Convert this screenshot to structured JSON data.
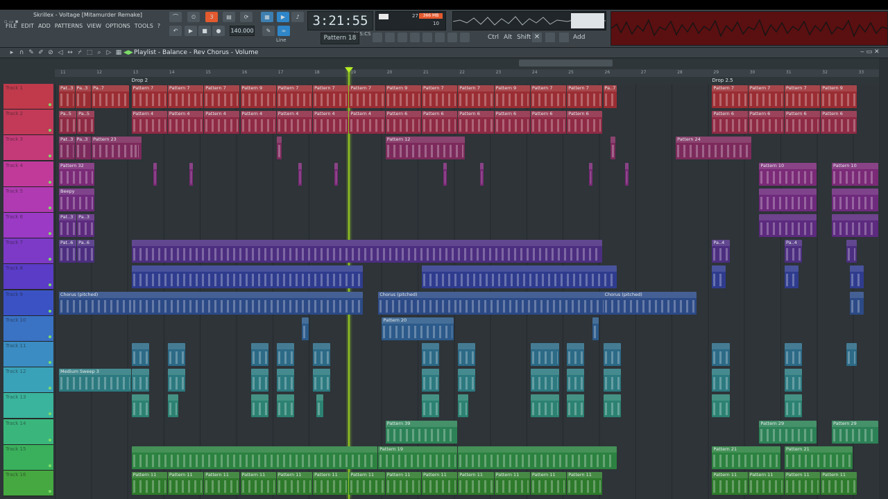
{
  "window": {
    "title": "Skrillex - Voltage [Mitamurder Remake]",
    "menu": [
      "FILE",
      "EDIT",
      "ADD",
      "PATTERNS",
      "VIEW",
      "OPTIONS",
      "TOOLS",
      "?"
    ]
  },
  "transport": {
    "time": "3:21:55",
    "bars_label": "M:S:CS",
    "tempo": "140.000",
    "pattern": "Pattern 18",
    "snap": "Line",
    "cpu_text": "27",
    "mem_text": "366 MB",
    "poly_text": "10"
  },
  "keys": [
    "Ctrl",
    "Alt",
    "Shift",
    "Add"
  ],
  "colors": {
    "accent_orange": "#e35a2f",
    "playhead": "#8fc41f",
    "oscilloscope": "#c01818"
  },
  "playlist": {
    "title": "Playlist - Balance - Rev Chorus - Volume",
    "bars": [
      "11",
      "12",
      "13",
      "14",
      "15",
      "16",
      "17",
      "18",
      "19",
      "20",
      "21",
      "22",
      "23",
      "24",
      "25",
      "26",
      "27",
      "28",
      "29",
      "30",
      "31",
      "32",
      "33"
    ],
    "markers": [
      {
        "text": "Drop 2",
        "bar": 13
      },
      {
        "text": "Drop 2.5",
        "bar": 29
      }
    ],
    "tracks": [
      {
        "name": "Track 1",
        "color": "#c03a4c",
        "clip_color": "#9a2d33",
        "clips": [
          [
            "Pat..3",
            11,
            11.45
          ],
          [
            "Pa..3",
            11.45,
            11.9
          ],
          [
            "Pa..7",
            11.9,
            12.95
          ],
          [
            "Pattern 7",
            13,
            14
          ],
          [
            "Pattern 7",
            14,
            15
          ],
          [
            "Pattern 7",
            15,
            16
          ],
          [
            "Pattern 9",
            16,
            17
          ],
          [
            "Pattern 7",
            17,
            18
          ],
          [
            "Pattern 7",
            18,
            19
          ],
          [
            "Pattern 7",
            19,
            20
          ],
          [
            "Pattern 9",
            20,
            21
          ],
          [
            "Pattern 7",
            21,
            22
          ],
          [
            "Pattern 7",
            22,
            23
          ],
          [
            "Pattern 9",
            23,
            24
          ],
          [
            "Pattern 7",
            24,
            25
          ],
          [
            "Pattern 7",
            25,
            26
          ],
          [
            "Pa..7",
            26,
            26.4
          ],
          [
            "Pattern 7",
            29,
            30
          ],
          [
            "Pattern 7",
            30,
            31
          ],
          [
            "Pattern 7",
            31,
            32
          ],
          [
            "Pattern 9",
            32,
            33
          ]
        ]
      },
      {
        "name": "Track 2",
        "color": "#c23a58",
        "clip_color": "#8e2a44",
        "clips": [
          [
            "Pa..5",
            11,
            11.5
          ],
          [
            "Pa..5",
            11.5,
            12
          ],
          [
            "Pattern 4",
            13,
            14
          ],
          [
            "Pattern 4",
            14,
            15
          ],
          [
            "Pattern 4",
            15,
            16
          ],
          [
            "Pattern 4",
            16,
            17
          ],
          [
            "Pattern 4",
            17,
            18
          ],
          [
            "Pattern 4",
            18,
            19
          ],
          [
            "Pattern 4",
            19,
            20
          ],
          [
            "Pattern 6",
            20,
            21
          ],
          [
            "Pattern 6",
            21,
            22
          ],
          [
            "Pattern 6",
            22,
            23
          ],
          [
            "Pattern 6",
            23,
            24
          ],
          [
            "Pattern 6",
            24,
            25
          ],
          [
            "Pattern 6",
            25,
            26
          ],
          [
            "Pattern 6",
            29,
            30
          ],
          [
            "Pattern 6",
            30,
            31
          ],
          [
            "Pattern 6",
            31,
            32
          ],
          [
            "Pattern 6",
            32,
            33
          ]
        ]
      },
      {
        "name": "Track 3",
        "color": "#c43a78",
        "clip_color": "#7c2a5c",
        "clips": [
          [
            "Pat..3",
            11,
            11.45
          ],
          [
            "Pa..3",
            11.45,
            11.9
          ],
          [
            "Pattern 23",
            11.9,
            13.3
          ],
          [
            "",
            13.05,
            13.2
          ],
          [
            "",
            17,
            17.15
          ],
          [
            "Pattern 12",
            20,
            22.2
          ],
          [
            "",
            26.2,
            26.35
          ],
          [
            "Pattern 24",
            28,
            30.1
          ]
        ]
      },
      {
        "name": "Track 4",
        "color": "#c13a9a",
        "clip_color": "#7a2a76",
        "clips": [
          [
            "Pattern 32",
            11,
            12
          ],
          [
            "",
            13.6,
            13.7
          ],
          [
            "",
            14.6,
            14.7
          ],
          [
            "",
            17.6,
            17.7
          ],
          [
            "",
            18.6,
            18.7
          ],
          [
            "",
            21.6,
            21.7
          ],
          [
            "",
            22.6,
            22.7
          ],
          [
            "",
            25.6,
            25.7
          ],
          [
            "",
            26.6,
            26.7
          ],
          [
            "Pattern 10",
            30.3,
            31.9
          ],
          [
            "Pattern 10",
            32.3,
            33.6
          ]
        ]
      },
      {
        "name": "Track 5",
        "color": "#b03ab2",
        "clip_color": "#6e2a7c",
        "clips": [
          [
            "Beepy",
            11,
            12
          ],
          [
            "",
            30.3,
            31.9
          ],
          [
            "",
            32.3,
            33.6
          ]
        ]
      },
      {
        "name": "Track 6",
        "color": "#9b3ac4",
        "clip_color": "#5c2a7e",
        "clips": [
          [
            "Pat..3",
            11,
            11.5
          ],
          [
            "Pa..3",
            11.5,
            12
          ],
          [
            "",
            30.3,
            31.9
          ],
          [
            "",
            32.3,
            33.6
          ]
        ]
      },
      {
        "name": "Track 7",
        "color": "#7c3ac6",
        "clip_color": "#4c2e80",
        "clips": [
          [
            "Pat..6",
            11,
            11.5
          ],
          [
            "Pa..6",
            11.5,
            12
          ],
          [
            "",
            13,
            26
          ],
          [
            "Pa..4",
            29,
            29.5
          ],
          [
            "Pa..4",
            31,
            31.5
          ],
          [
            "",
            32.7,
            33
          ]
        ]
      },
      {
        "name": "Track 8",
        "color": "#5a3cc6",
        "clip_color": "#2f3c8e",
        "clips": [
          [
            "",
            13,
            19.4
          ],
          [
            "",
            21,
            26.4
          ],
          [
            "",
            29,
            29.4
          ],
          [
            "",
            31,
            31.4
          ],
          [
            "",
            32.8,
            33.2
          ]
        ]
      },
      {
        "name": "Track 9",
        "color": "#3a52c4",
        "clip_color": "#2c4a86",
        "clips": [
          [
            "Chorus (pitched)",
            11,
            13.5
          ],
          [
            "",
            13,
            19.4
          ],
          [
            "Chorus (pitched)",
            19.8,
            22.3
          ],
          [
            "",
            22,
            26.4
          ],
          [
            "Chorus (pitched)",
            26,
            28.6
          ],
          [
            "",
            32.8,
            33.2
          ]
        ]
      },
      {
        "name": "Track 10",
        "color": "#3a72c4",
        "clip_color": "#2c5a8a",
        "clips": [
          [
            "",
            17.7,
            17.9
          ],
          [
            "Pattern 20",
            19.9,
            21.9
          ],
          [
            "",
            25.7,
            25.9
          ]
        ]
      },
      {
        "name": "Track 11",
        "color": "#3a8cc2",
        "clip_color": "#2c6a86",
        "clips": [
          [
            "",
            13,
            13.5
          ],
          [
            "",
            14,
            14.5
          ],
          [
            "",
            16.3,
            16.8
          ],
          [
            "",
            17,
            17.5
          ],
          [
            "",
            18,
            18.5
          ],
          [
            "",
            21,
            21.5
          ],
          [
            "",
            22,
            22.5
          ],
          [
            "",
            24,
            24.8
          ],
          [
            "",
            25,
            25.5
          ],
          [
            "",
            26,
            26.5
          ],
          [
            "",
            29,
            29.5
          ],
          [
            "",
            31,
            31.5
          ],
          [
            "",
            32.7,
            33
          ]
        ]
      },
      {
        "name": "Track 12",
        "color": "#3aa2b8",
        "clip_color": "#2c7a80",
        "clips": [
          [
            "Medium Sweep 3",
            11,
            13
          ],
          [
            "",
            13,
            13.5
          ],
          [
            "",
            14,
            14.5
          ],
          [
            "",
            16.3,
            16.8
          ],
          [
            "",
            17,
            17.5
          ],
          [
            "",
            18,
            18.5
          ],
          [
            "",
            21,
            21.5
          ],
          [
            "",
            22,
            22.5
          ],
          [
            "",
            24,
            24.8
          ],
          [
            "",
            25,
            25.5
          ],
          [
            "",
            26,
            26.5
          ],
          [
            "",
            29,
            29.5
          ],
          [
            "",
            31,
            31.5
          ]
        ]
      },
      {
        "name": "Track 13",
        "color": "#3ab49c",
        "clip_color": "#2c8272",
        "clips": [
          [
            "",
            13,
            13.5
          ],
          [
            "",
            14,
            14.3
          ],
          [
            "",
            16.3,
            16.8
          ],
          [
            "",
            17,
            17.5
          ],
          [
            "",
            18.1,
            18.3
          ],
          [
            "",
            21,
            21.5
          ],
          [
            "",
            22,
            22.3
          ],
          [
            "",
            24,
            24.8
          ],
          [
            "",
            25,
            25.5
          ],
          [
            "",
            26,
            26.5
          ],
          [
            "",
            29,
            29.5
          ],
          [
            "",
            31,
            31.5
          ]
        ]
      },
      {
        "name": "Track 14",
        "color": "#3ab67c",
        "clip_color": "#2c8256",
        "clips": [
          [
            "Pattern 39",
            20,
            22
          ],
          [
            "Pattern 29",
            30.3,
            31.9
          ],
          [
            "Pattern 29",
            32.3,
            33.6
          ]
        ]
      },
      {
        "name": "Track 15",
        "color": "#3ab05c",
        "clip_color": "#2c8240",
        "clips": [
          [
            "",
            13,
            19.8
          ],
          [
            "Pattern 19",
            19.8,
            22
          ],
          [
            "",
            22,
            26.4
          ],
          [
            "Pattern 21",
            29,
            30.9
          ],
          [
            "Pattern 21",
            31,
            32.9
          ]
        ]
      },
      {
        "name": "Track 16",
        "color": "#46a840",
        "clip_color": "#2e7a2c",
        "clips": [
          [
            "Pattern 11",
            13,
            14
          ],
          [
            "Pattern 11",
            14,
            15
          ],
          [
            "Pattern 11",
            15,
            16
          ],
          [
            "Pattern 11",
            16,
            17
          ],
          [
            "Pattern 11",
            17,
            18
          ],
          [
            "Pattern 11",
            18,
            19
          ],
          [
            "Pattern 11",
            19,
            20
          ],
          [
            "Pattern 11",
            20,
            21
          ],
          [
            "Pattern 11",
            21,
            22
          ],
          [
            "Pattern 11",
            22,
            23
          ],
          [
            "Pattern 11",
            23,
            24
          ],
          [
            "Pattern 11",
            24,
            25
          ],
          [
            "Pattern 11",
            25,
            26
          ],
          [
            "Pattern 11",
            29,
            30
          ],
          [
            "Pattern 11",
            30,
            31
          ],
          [
            "Pattern 11",
            31,
            32
          ],
          [
            "Pattern 11",
            32,
            33
          ]
        ]
      }
    ]
  }
}
